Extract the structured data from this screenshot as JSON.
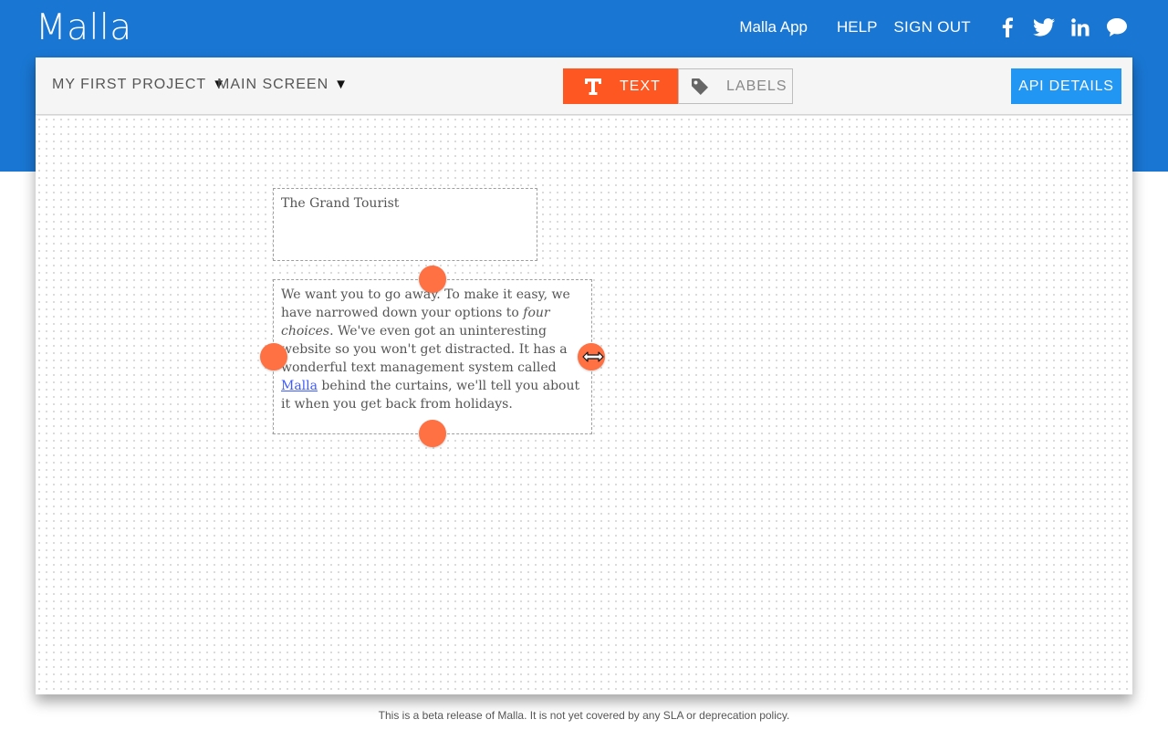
{
  "app": {
    "logo": "Malla"
  },
  "topnav": {
    "app_link": "Malla App",
    "help": "HELP",
    "sign_out": "SIGN OUT",
    "social_icons": [
      "facebook-icon",
      "twitter-icon",
      "linkedin-icon",
      "chat-icon"
    ]
  },
  "toolbar": {
    "project": "MY FIRST PROJECT",
    "screen": "MAIN SCREEN",
    "dropdown_arrow": "▼",
    "mode_text": "TEXT",
    "mode_labels": "LABELS",
    "active_mode": "TEXT",
    "api_button": "API DETAILS"
  },
  "canvas": {
    "title_box": {
      "text": "The Grand Tourist"
    },
    "body_box": {
      "part1": "We want you to go away. To make it easy, we have narrowed down your options to ",
      "emphasis": "four choices",
      "part2": ". We've even got an uninteresting website so you won't get distracted. It has a wonderful text management system called ",
      "link_text": "Malla",
      "part3": " behind the curtains, we'll tell you about it when you get back from holidays."
    }
  },
  "footer": {
    "text": "This is a beta release of Malla. It is not yet covered by any SLA or deprecation policy."
  },
  "colors": {
    "header_blue": "#1976d2",
    "accent_orange": "#ff5722",
    "handle_orange": "#ff7043",
    "api_blue": "#2196f3",
    "link_blue": "#3d5afe"
  }
}
